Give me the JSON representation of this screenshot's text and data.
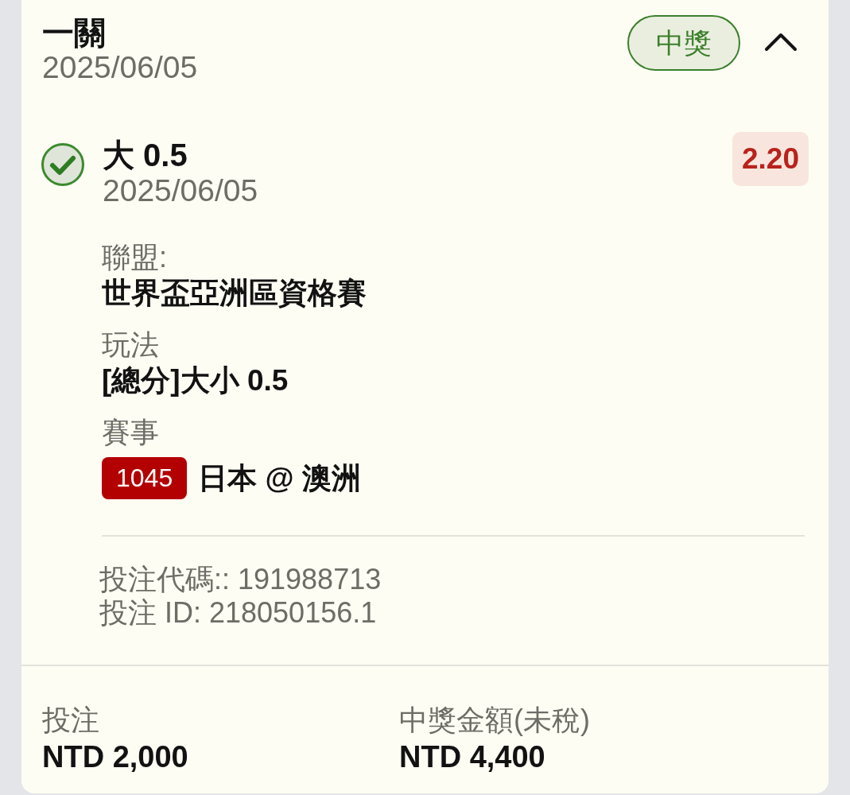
{
  "bet": {
    "title": "一關",
    "date": "2025/06/05",
    "status": "中獎",
    "expanded": true
  },
  "selection": {
    "won": true,
    "pick": "大 0.5",
    "date": "2025/06/05",
    "odds": "2.20",
    "details": [
      {
        "kind": "text",
        "label": "聯盟:",
        "value": "世界盃亞洲區資格賽"
      },
      {
        "kind": "text",
        "label": "玩法",
        "value": "[總分]大小 0.5"
      },
      {
        "kind": "match",
        "label": "賽事",
        "match_number": "1045",
        "value": "日本 @ 澳洲"
      }
    ],
    "references": [
      "投注代碼:: 191988713",
      "投注 ID: 218050156.1"
    ]
  },
  "summary": [
    {
      "label": "投注",
      "value": "NTD 2,000"
    },
    {
      "label": "中獎金額(未稅)",
      "value": "NTD 4,400"
    }
  ]
}
